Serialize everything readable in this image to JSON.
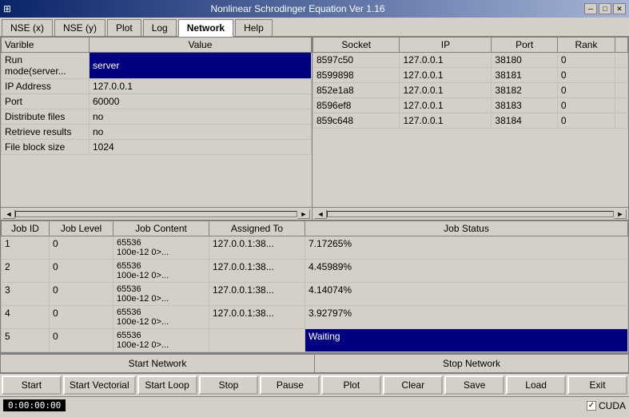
{
  "window": {
    "title": "Nonlinear Schrodinger Equation Ver 1.16",
    "icon": "⊞"
  },
  "titlebar": {
    "minimize": "─",
    "maximize": "□",
    "close": "✕"
  },
  "menu": {
    "tabs": [
      {
        "label": "NSE (x)",
        "active": false
      },
      {
        "label": "NSE (y)",
        "active": false
      },
      {
        "label": "Plot",
        "active": false
      },
      {
        "label": "Log",
        "active": false
      },
      {
        "label": "Network",
        "active": true
      },
      {
        "label": "Help",
        "active": false
      }
    ]
  },
  "left_table": {
    "headers": [
      "Varible",
      "Value"
    ],
    "rows": [
      {
        "varible": "Run mode(server...",
        "value": "server",
        "highlight": true
      },
      {
        "varible": "IP Address",
        "value": "127.0.0.1",
        "highlight": false
      },
      {
        "varible": "Port",
        "value": "60000",
        "highlight": false
      },
      {
        "varible": "Distribute files",
        "value": "no",
        "highlight": false
      },
      {
        "varible": "Retrieve results",
        "value": "no",
        "highlight": false
      },
      {
        "varible": "File block size",
        "value": "1024",
        "highlight": false
      }
    ]
  },
  "right_table": {
    "headers": [
      "Socket",
      "IP",
      "Port",
      "Rank"
    ],
    "rows": [
      {
        "socket": "8597c50",
        "ip": "127.0.0.1",
        "port": "38180",
        "rank": "0"
      },
      {
        "socket": "8599898",
        "ip": "127.0.0.1",
        "port": "38181",
        "rank": "0"
      },
      {
        "socket": "852e1a8",
        "ip": "127.0.0.1",
        "port": "38182",
        "rank": "0"
      },
      {
        "socket": "8596ef8",
        "ip": "127.0.0.1",
        "port": "38183",
        "rank": "0"
      },
      {
        "socket": "859c648",
        "ip": "127.0.0.1",
        "port": "38184",
        "rank": "0"
      }
    ]
  },
  "jobs_table": {
    "headers": [
      "Job ID",
      "Job Level",
      "Job Content",
      "Assigned To",
      "Job Status"
    ],
    "rows": [
      {
        "id": "1",
        "level": "0",
        "content": "65536\n100e-12 0>...",
        "assigned": "127.0.0.1:38...",
        "status": "7.17265%",
        "waiting": false
      },
      {
        "id": "2",
        "level": "0",
        "content": "65536\n100e-12 0>...",
        "assigned": "127.0.0.1:38...",
        "status": "4.45989%",
        "waiting": false
      },
      {
        "id": "3",
        "level": "0",
        "content": "65536\n100e-12 0>...",
        "assigned": "127.0.0.1:38...",
        "status": "4.14074%",
        "waiting": false
      },
      {
        "id": "4",
        "level": "0",
        "content": "65536\n100e-12 0>...",
        "assigned": "127.0.0.1:38...",
        "status": "3.92797%",
        "waiting": false
      },
      {
        "id": "5",
        "level": "0",
        "content": "65536\n100e-12 0>...",
        "assigned": "",
        "status": "Waiting",
        "waiting": true
      }
    ]
  },
  "network_buttons": {
    "start": "Start Network",
    "stop": "Stop Network"
  },
  "action_buttons": {
    "start": "Start",
    "start_vectorial": "Start Vectorial",
    "start_loop": "Start Loop",
    "stop": "Stop",
    "pause": "Pause",
    "plot": "Plot",
    "clear": "Clear",
    "save": "Save",
    "load": "Load",
    "exit": "Exit"
  },
  "status_bar": {
    "time": "0:00:00:00",
    "cuda_label": "CUDA",
    "cuda_checked": true
  }
}
